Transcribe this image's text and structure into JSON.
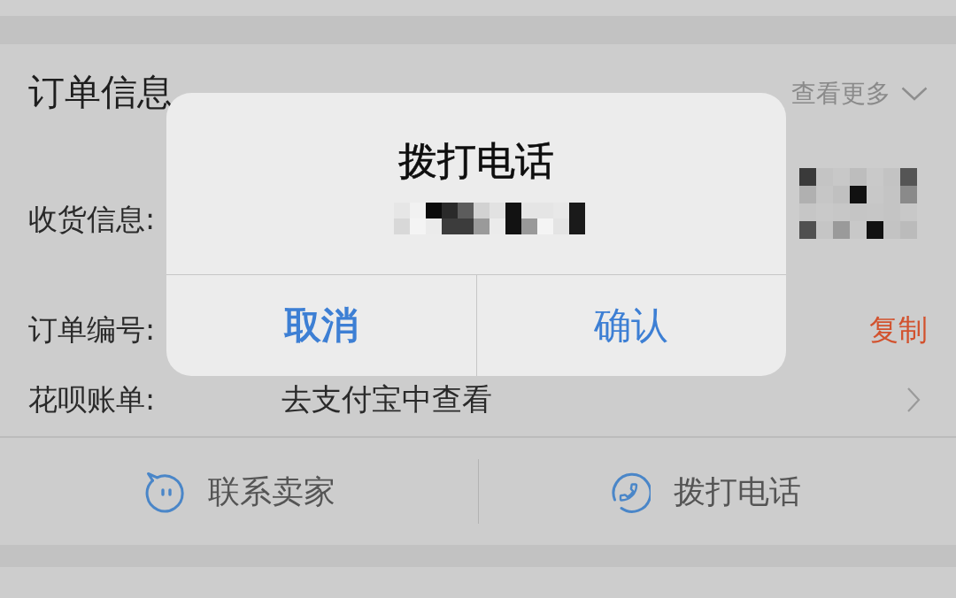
{
  "order_info": {
    "title": "订单信息",
    "more_link": "查看更多",
    "rows": [
      {
        "kind": "redacted",
        "label": "收货信息:"
      },
      {
        "kind": "copy",
        "label": "订单编号:",
        "action": "复制"
      },
      {
        "kind": "link",
        "label": "花呗账单:",
        "value": "去支付宝中查看"
      }
    ]
  },
  "bottom_actions": [
    {
      "kind": "chat",
      "label": "联系卖家"
    },
    {
      "kind": "phone",
      "label": "拨打电话"
    }
  ],
  "dialog": {
    "title": "拨打电话",
    "number_pixelated": true,
    "buttons": [
      {
        "label": "取消",
        "bold": true
      },
      {
        "label": "确认",
        "bold": false
      }
    ]
  }
}
